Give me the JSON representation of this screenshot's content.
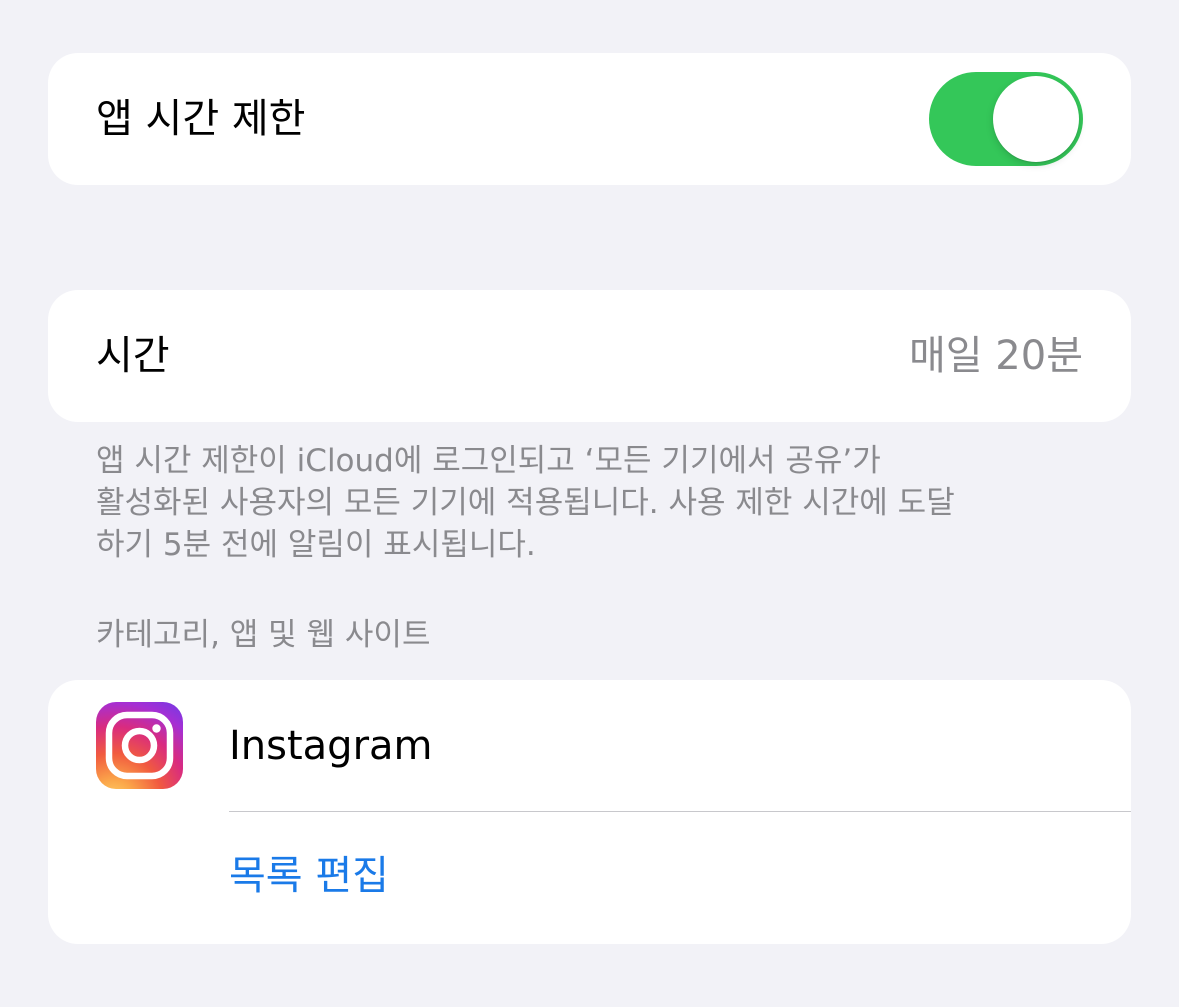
{
  "app_limit": {
    "label": "앱 시간 제한",
    "enabled": true,
    "toggle_color": "#34c759"
  },
  "time": {
    "label": "시간",
    "value": "매일 20분"
  },
  "footer_note": {
    "lines": [
      "앱 시간 제한이 iCloud에 로그인되고 ‘모든 기기에서 공유’가",
      "활성화된 사용자의 모든 기기에 적용됩니다. 사용 제한 시간에 도달",
      "하기 5분 전에 알림이 표시됩니다."
    ]
  },
  "apps_section": {
    "header": "카테고리, 앱 및 웹 사이트",
    "items": [
      {
        "name": "Instagram",
        "icon": "instagram-icon"
      }
    ],
    "edit_label": "목록 편집",
    "link_color": "#1a7ae8"
  }
}
